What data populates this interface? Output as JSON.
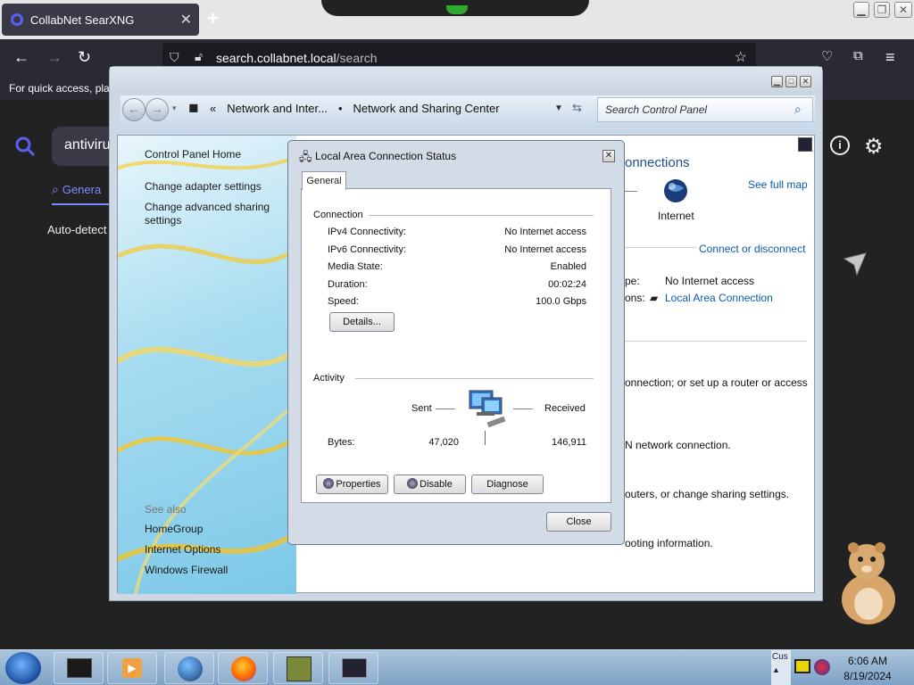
{
  "browser": {
    "tab_title": "CollabNet SearXNG",
    "url_host": "search.collabnet.local",
    "url_path": "/search",
    "bookmarks_text": "For quick access, plac"
  },
  "search_page": {
    "query": "antiviru",
    "tab_general": "Genera",
    "autodetect": "Auto-detect"
  },
  "control_panel": {
    "breadcrumb": [
      "Network and Inter...",
      "Network and Sharing Center"
    ],
    "search_placeholder": "Search Control Panel",
    "sidebar": {
      "home": "Control Panel Home",
      "links": [
        "Change adapter settings",
        "Change advanced sharing settings"
      ],
      "see_also": "See also",
      "see_also_links": [
        "HomeGroup",
        "Internet Options",
        "Windows Firewall"
      ]
    },
    "main": {
      "heading_fragment": "onnections",
      "see_full_map": "See full map",
      "internet_label": "Internet",
      "connect_disconnect": "Connect or disconnect",
      "access_type_label": "pe:",
      "access_type_value": "No Internet access",
      "connections_label": "ons:",
      "connections_value": "Local Area Connection",
      "task1": "onnection; or set up a router or access",
      "task2": "N network connection.",
      "task3": "outers, or change sharing settings.",
      "task4": "ooting information."
    }
  },
  "dialog": {
    "title": "Local Area Connection Status",
    "tab": "General",
    "connection_group": "Connection",
    "rows": [
      {
        "label": "IPv4 Connectivity:",
        "value": "No Internet access"
      },
      {
        "label": "IPv6 Connectivity:",
        "value": "No Internet access"
      },
      {
        "label": "Media State:",
        "value": "Enabled"
      },
      {
        "label": "Duration:",
        "value": "00:02:24"
      },
      {
        "label": "Speed:",
        "value": "100.0 Gbps"
      }
    ],
    "details_button": "Details...",
    "activity_group": "Activity",
    "sent_label": "Sent",
    "received_label": "Received",
    "bytes_label": "Bytes:",
    "bytes_sent": "47,020",
    "bytes_received": "146,911",
    "properties_button": "Properties",
    "disable_button": "Disable",
    "diagnose_button": "Diagnose",
    "close_button": "Close"
  },
  "taskbar": {
    "tray_label": "Cus",
    "time": "6:06 AM",
    "date": "8/19/2024"
  },
  "colors": {
    "firefox_dark": "#2b2a33",
    "link_blue": "#0b5ab5",
    "searx_accent": "#7b8cff"
  }
}
